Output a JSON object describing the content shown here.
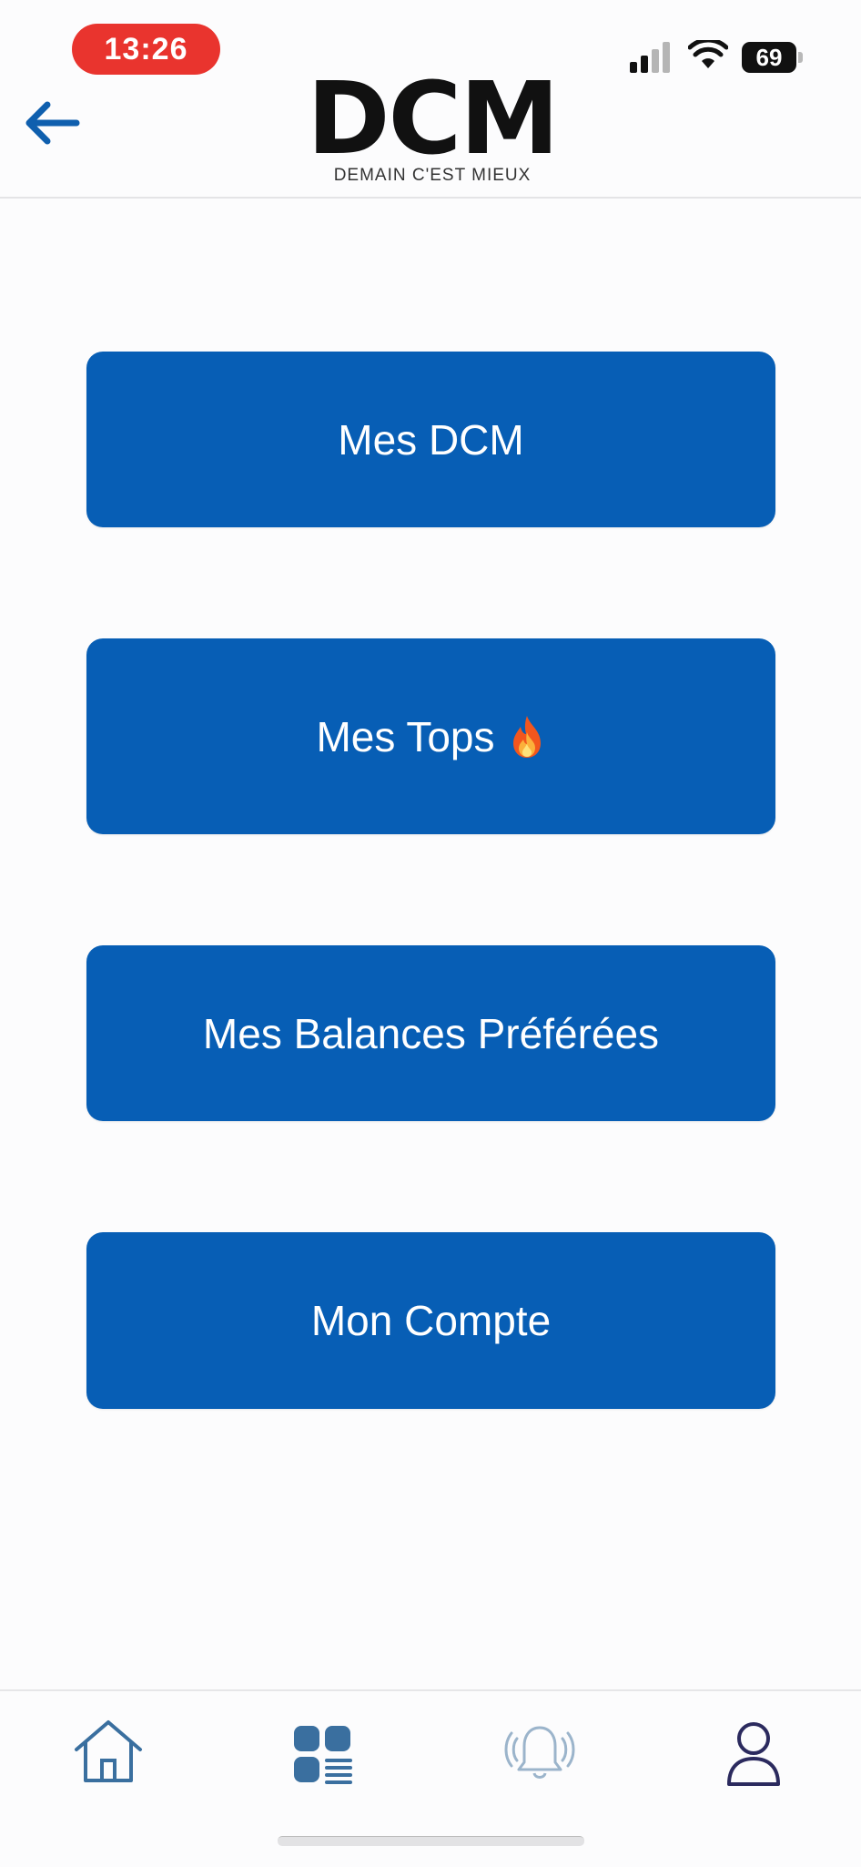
{
  "status_bar": {
    "time": "13:26",
    "battery": "69"
  },
  "header": {
    "logo_title": "DCM",
    "logo_subtitle": "DEMAIN C'EST MIEUX",
    "back_icon": "arrow-left-icon"
  },
  "menu": {
    "items": [
      {
        "label": "Mes DCM"
      },
      {
        "label": "Mes Tops",
        "emoji": "fire-icon"
      },
      {
        "label": "Mes Balances Préférées"
      },
      {
        "label": "Mon Compte"
      }
    ]
  },
  "tab_bar": {
    "tabs": [
      {
        "icon": "home-icon"
      },
      {
        "icon": "grid-list-icon",
        "active": true
      },
      {
        "icon": "bell-icon"
      },
      {
        "icon": "user-icon"
      }
    ]
  },
  "colors": {
    "primary": "#075eb5",
    "time_pill": "#e9342e",
    "tab_icon": "#3a6f9f",
    "user_icon": "#2b2a5e"
  }
}
